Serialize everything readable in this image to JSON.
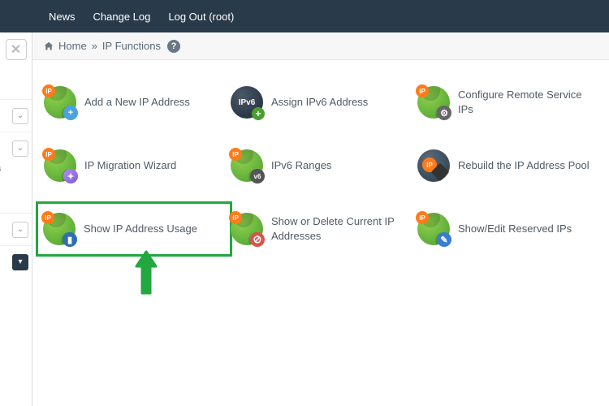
{
  "topnav": {
    "news": "News",
    "changelog": "Change Log",
    "logout": "Log Out (root)"
  },
  "breadcrumb": {
    "home": "Home",
    "sep": "»",
    "current": "IP Functions"
  },
  "sidebar_letter": "a",
  "items": {
    "add_ip": "Add a New IP Address",
    "assign_ipv6": "Assign IPv6 Address",
    "configure_remote": "Configure Remote Service IPs",
    "migration": "IP Migration Wizard",
    "ipv6_ranges": "IPv6 Ranges",
    "rebuild": "Rebuild the IP Address Pool",
    "show_usage": "Show IP Address Usage",
    "show_delete": "Show or Delete Current IP Addresses",
    "reserved": "Show/Edit Reserved IPs"
  },
  "badges": {
    "ip": "IP",
    "ipv6": "IPv6"
  },
  "highlight": "show_usage",
  "colors": {
    "highlight_border": "#22a83f",
    "topbar": "#293a4a",
    "accent_orange": "#ff7b1a"
  }
}
